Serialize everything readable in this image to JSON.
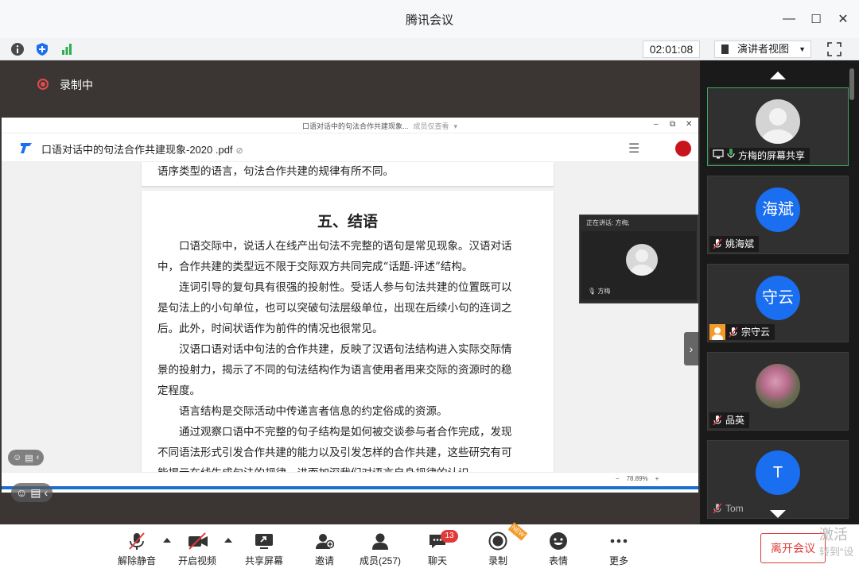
{
  "window": {
    "title": "腾讯会议",
    "minimize": "—",
    "maximize": "☐",
    "close": "✕"
  },
  "infobar": {
    "timer": "02:01:08",
    "view_label": "演讲者视图"
  },
  "recording": {
    "label": "录制中"
  },
  "pdf_window": {
    "caption": "口语对话中的句法合作共建现象...",
    "caption_sub": "成员仅查看",
    "file_name": "口语对话中的句法合作共建现象-2020 .pdf",
    "zoom": "78.89%",
    "zoom_minus": "−",
    "zoom_plus": "+"
  },
  "document": {
    "prev_page_line": "语序类型的语言，句法合作共建的规律有所不同。",
    "heading": "五、结语",
    "lines": [
      "　　口语交际中，说话人在线产出句法不完整的语句是常见现象。汉语对话",
      "中，合作共建的类型远不限于交际双方共同完成“话题-评述”结构。",
      "　　连词引导的复句具有很强的投射性。受话人参与句法共建的位置既可以",
      "是句法上的小句单位，也可以突破句法层级单位，出现在后续小句的连词之",
      "后。此外，时间状语作为前件的情况也很常见。",
      "　　汉语口语对话中句法的合作共建，反映了汉语句法结构进入实际交际情",
      "景的投射力，揭示了不同的句法结构作为语言使用者用来交际的资源时的稳",
      "定程度。",
      "　　语言结构是交际活动中传递言者信息的约定俗成的资源。",
      "　　通过观察口语中不完整的句子结构是如何被交谈参与者合作完成，发现",
      "不同语法形式引发合作共建的能力以及引发怎样的合作共建，这些研究有可",
      "能揭示在线生成句法的规律，进而加深我们对语言自身规律的认识。"
    ]
  },
  "speaker_panel": {
    "label": "正在讲话: 方梅;",
    "name": "方梅"
  },
  "participants": [
    {
      "name": "方梅的屏幕共享",
      "avatar_text": ""
    },
    {
      "name": "姚海斌",
      "avatar_text": "海斌"
    },
    {
      "name": "宗守云",
      "avatar_text": "守云"
    },
    {
      "name": "品英",
      "avatar_text": ""
    },
    {
      "name": "Tom",
      "avatar_text": "T"
    }
  ],
  "toolbar": {
    "unmute": "解除静音",
    "start_video": "开启视频",
    "share": "共享屏幕",
    "invite": "邀请",
    "members": "成员(257)",
    "chat": "聊天",
    "chat_badge": "13",
    "record": "录制",
    "record_tag": "NEW",
    "reactions": "表情",
    "more": "更多",
    "leave": "离开会议"
  },
  "watermark": {
    "line1": "激活",
    "line2": "转到“设"
  },
  "colors": {
    "accent_blue": "#1a6ef0",
    "danger_red": "#e23a3a",
    "active_green": "#3ba55c"
  }
}
